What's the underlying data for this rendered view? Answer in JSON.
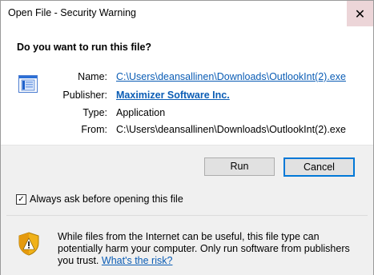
{
  "window": {
    "title": "Open File - Security Warning",
    "close_glyph": "✕"
  },
  "prompt": {
    "question": "Do you want to run this file?"
  },
  "file_info": {
    "name_label": "Name:",
    "name_value": "C:\\Users\\deansallinen\\Downloads\\OutlookInt(2).exe",
    "publisher_label": "Publisher:",
    "publisher_value": "Maximizer Software Inc.",
    "type_label": "Type:",
    "type_value": "Application",
    "from_label": "From:",
    "from_value": "C:\\Users\\deansallinen\\Downloads\\OutlookInt(2).exe",
    "icon": "application-file-icon"
  },
  "buttons": {
    "run_label": "Run",
    "cancel_label": "Cancel"
  },
  "options": {
    "always_ask_label": "Always ask before opening this file",
    "always_ask_checked": true,
    "check_glyph": "✓"
  },
  "warning": {
    "icon": "shield-warning-icon",
    "text": "While files from the Internet can be useful, this file type can potentially harm your computer. Only run software from publishers you trust.",
    "link_text": "What's the risk?"
  },
  "colors": {
    "link": "#0b5db5",
    "focus_border": "#0078d7",
    "close_hover": "#ecd5d8",
    "gray_panel": "#f0f0f0"
  }
}
